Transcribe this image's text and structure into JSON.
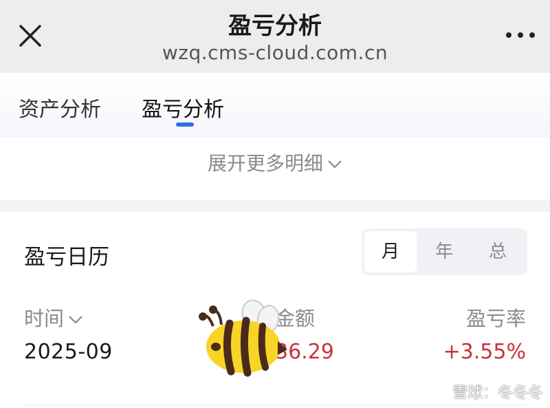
{
  "header": {
    "title": "盈亏分析",
    "url": "wzq.cms-cloud.com.cn",
    "close_icon": "close-icon",
    "more_icon": "more-horizontal-icon"
  },
  "tabs": [
    {
      "label": "资产分析",
      "active": false
    },
    {
      "label": "盈亏分析",
      "active": true
    }
  ],
  "expand": {
    "label": "展开更多明细",
    "icon": "chevron-down-icon"
  },
  "calendar": {
    "title": "盈亏日历",
    "segments": [
      {
        "label": "月",
        "selected": true
      },
      {
        "label": "年",
        "selected": false
      },
      {
        "label": "总",
        "selected": false
      }
    ],
    "columns": {
      "time": "时间",
      "amount": "金额",
      "rate": "盈亏率"
    },
    "rows": [
      {
        "date": "2025-09",
        "amount": "36.29",
        "rate": "+3.55%"
      }
    ]
  },
  "watermark": {
    "label": "雪球：冬冬冬"
  },
  "colors": {
    "accent": "#2f6fdc",
    "profit": "#c7333a",
    "header_bg": "#ededed"
  }
}
